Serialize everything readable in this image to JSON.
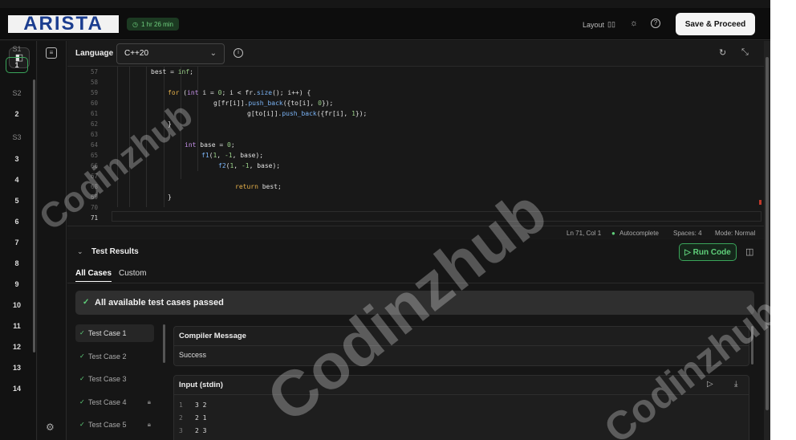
{
  "header": {
    "logo_text": "ARISTA",
    "timer": "1 hr 26 min",
    "layout_label": "Layout",
    "save_label": "Save & Proceed"
  },
  "sidebar": {
    "sections": [
      {
        "label": "S1",
        "items": [
          "1"
        ]
      },
      {
        "label": "S2",
        "items": [
          "2"
        ]
      },
      {
        "label": "S3",
        "items": [
          "3",
          "4",
          "5",
          "6",
          "7",
          "8",
          "9",
          "10",
          "11",
          "12",
          "13",
          "14"
        ]
      }
    ]
  },
  "toolbar": {
    "language_label": "Language",
    "language_value": "C++20"
  },
  "editor": {
    "line_numbers": [
      "57",
      "58",
      "59",
      "60",
      "61",
      "62",
      "63",
      "64",
      "65",
      "66",
      "67",
      "68",
      "69",
      "70",
      "71"
    ],
    "current_line": "71"
  },
  "status_bar": {
    "position": "Ln 71, Col 1",
    "autocomplete": "Autocomplete",
    "spaces": "Spaces: 4",
    "mode": "Mode: Normal"
  },
  "results": {
    "title": "Test Results",
    "run_label": "Run Code",
    "tabs": [
      "All Cases",
      "Custom"
    ],
    "banner": "All available test cases passed",
    "test_cases": [
      "Test Case 1",
      "Test Case 2",
      "Test Case 3",
      "Test Case 4",
      "Test Case 5"
    ],
    "compiler_title": "Compiler Message",
    "compiler_value": "Success",
    "stdin_title": "Input (stdin)",
    "stdin_lines": [
      {
        "n": "1",
        "text": "3 2"
      },
      {
        "n": "2",
        "text": "2 1"
      },
      {
        "n": "3",
        "text": "2 3"
      }
    ]
  },
  "watermark": "Codinzhub",
  "colors": {
    "accent_green": "#3aa55a",
    "background": "#161616"
  }
}
